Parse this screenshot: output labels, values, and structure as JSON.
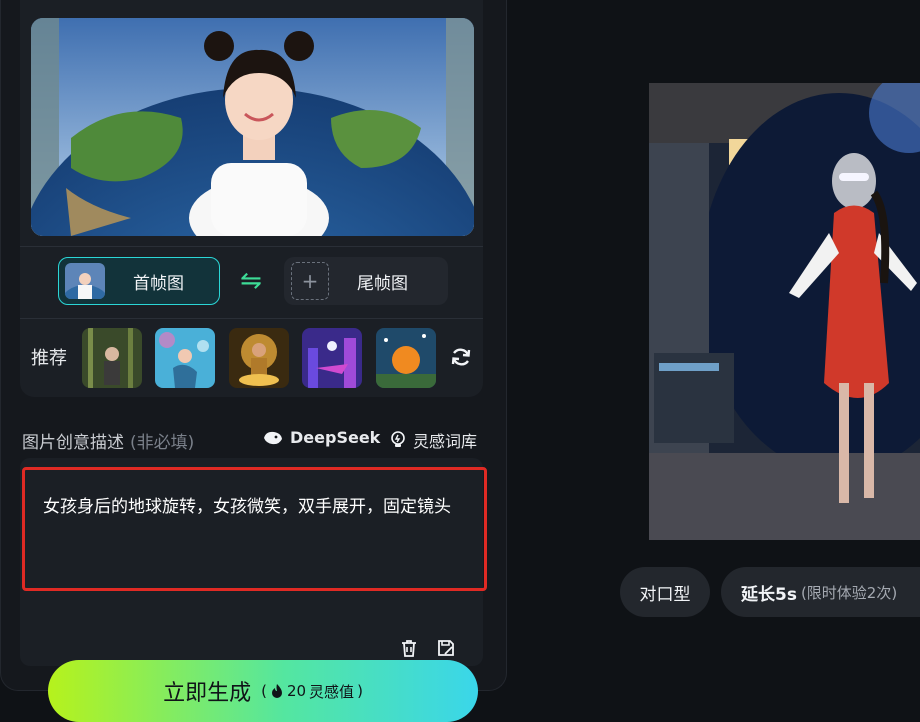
{
  "frames": {
    "first_label": "首帧图",
    "last_label": "尾帧图"
  },
  "recommend": {
    "label": "推荐",
    "thumbs": [
      "bamboo",
      "underwater",
      "golden-lotus",
      "cyber-city",
      "pumpkin-house"
    ]
  },
  "description": {
    "label": "图片创意描述",
    "hint": "(非必填)",
    "deepseek_label": "DeepSeek",
    "inspiration_label": "灵感词库",
    "prompt_text": "女孩身后的地球旋转，女孩微笑，双手展开，固定镜头"
  },
  "generate": {
    "label": "立即生成",
    "cost_open": "(",
    "cost_value": "20",
    "cost_unit": "灵感值",
    "cost_close": ")"
  },
  "preview_chips": {
    "lip_sync": "对口型",
    "extend": "延长5s",
    "extend_note": "(限时体验2次)"
  },
  "colors": {
    "accent_cyan": "#2bd6d6",
    "highlight_red": "#e02a24",
    "swap_green": "#3ddc97"
  }
}
